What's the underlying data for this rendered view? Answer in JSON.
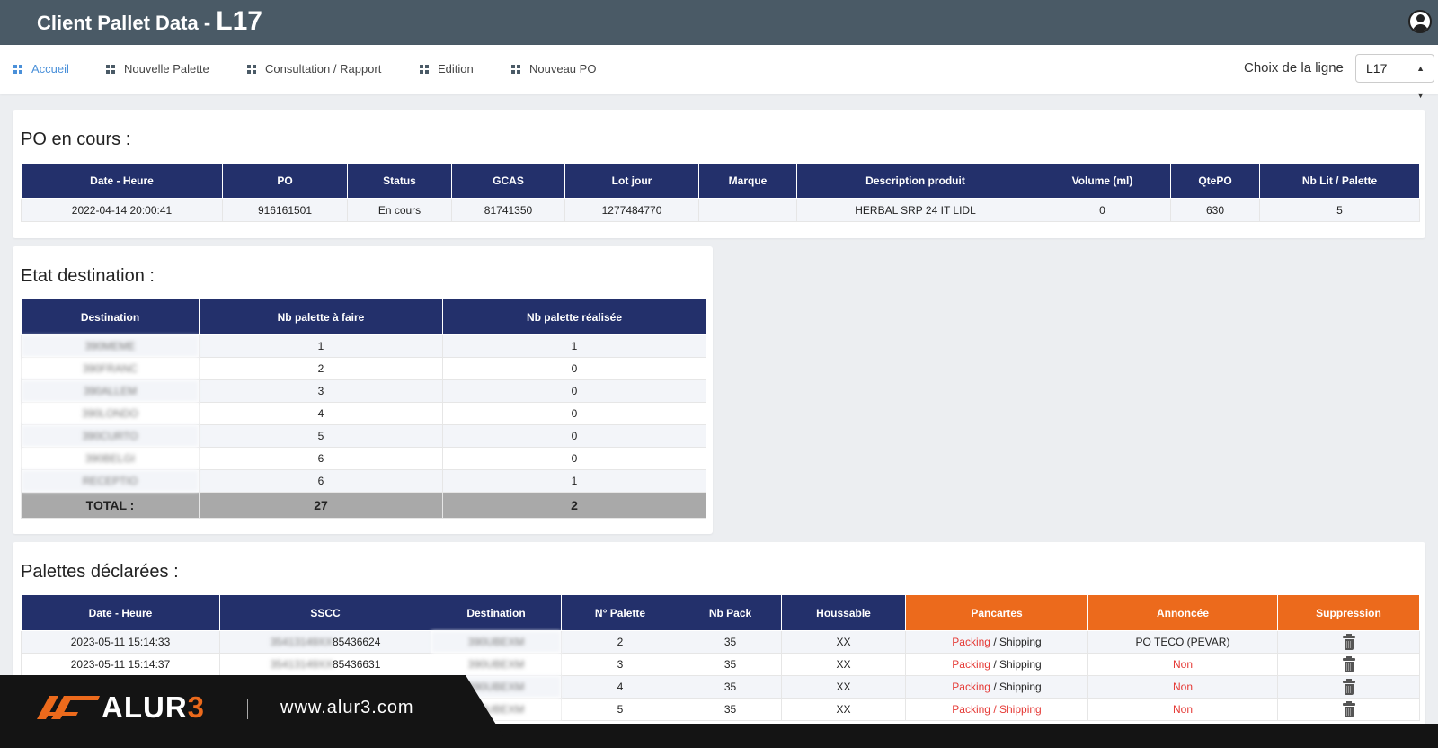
{
  "header": {
    "title": "Client Pallet Data - ",
    "line": "L17"
  },
  "nav": {
    "items": [
      {
        "label": "Accueil",
        "active": true
      },
      {
        "label": "Nouvelle Palette"
      },
      {
        "label": "Consultation / Rapport"
      },
      {
        "label": "Edition"
      },
      {
        "label": "Nouveau PO"
      }
    ],
    "choix_label": "Choix de la ligne",
    "line_value": "L17"
  },
  "po": {
    "title": "PO en cours :",
    "columns": [
      "Date - Heure",
      "PO",
      "Status",
      "GCAS",
      "Lot jour",
      "Marque",
      "Description produit",
      "Volume (ml)",
      "QtePO",
      "Nb Lit / Palette"
    ],
    "row": [
      "2022-04-14 20:00:41",
      "916161501",
      "En cours",
      "81741350",
      "1277484770",
      "",
      "HERBAL SRP 24 IT LIDL",
      "0",
      "630",
      "5"
    ]
  },
  "destination": {
    "title": "Etat destination :",
    "columns": [
      "Destination",
      "Nb palette à faire",
      "Nb palette réalisée"
    ],
    "rows": [
      [
        "390MEME",
        "1",
        "1"
      ],
      [
        "390FRANC",
        "2",
        "0"
      ],
      [
        "390ALLEM",
        "3",
        "0"
      ],
      [
        "390LONDO",
        "4",
        "0"
      ],
      [
        "390CURTO",
        "5",
        "0"
      ],
      [
        "390BELGI",
        "6",
        "0"
      ],
      [
        "RECEPTIO",
        "6",
        "1"
      ]
    ],
    "total_label": "TOTAL :",
    "total_a_faire": "27",
    "total_realisee": "2"
  },
  "palettes": {
    "title": "Palettes déclarées :",
    "columns": [
      "Date - Heure",
      "SSCC",
      "Destination",
      "N° Palette",
      "Nb Pack",
      "Houssable",
      "Pancartes",
      "Annoncée",
      "Suppression"
    ],
    "packing": "Packing",
    "slash": "/",
    "shipping": "Shipping",
    "rows": [
      {
        "date": "2023-05-11 15:14:33",
        "sscc_hidden": "35413149XX",
        "sscc_visible": "85436624",
        "dest": "390UBEXM",
        "num": "2",
        "pack": "35",
        "houss": "XX",
        "annoncee": "PO TECO (PEVAR)"
      },
      {
        "date": "2023-05-11 15:14:37",
        "sscc_hidden": "35413149XX",
        "sscc_visible": "85436631",
        "dest": "390UBEXM",
        "num": "3",
        "pack": "35",
        "houss": "XX",
        "annoncee": "Non"
      },
      {
        "date": "",
        "sscc_hidden": "",
        "sscc_visible": "",
        "dest": "390UBEXM",
        "num": "4",
        "pack": "35",
        "houss": "XX",
        "annoncee": "Non"
      },
      {
        "date": "",
        "sscc_hidden": "",
        "sscc_visible": "",
        "dest": "390UBEXM",
        "num": "5",
        "pack": "35",
        "houss": "XX",
        "annoncee": "Non"
      }
    ]
  },
  "brand": {
    "logo": "ALUR3",
    "website": "www.alur3.com"
  },
  "colors": {
    "topbar": "#4a5a66",
    "table_header": "#23306b",
    "orange_header": "#ec6a1c",
    "red_text": "#e53935",
    "total_row": "#a9a9a9",
    "active_nav": "#4a90d9"
  },
  "icons": {
    "user": "user-circle-icon",
    "nav": "grid-icon",
    "delete": "trash-icon"
  }
}
